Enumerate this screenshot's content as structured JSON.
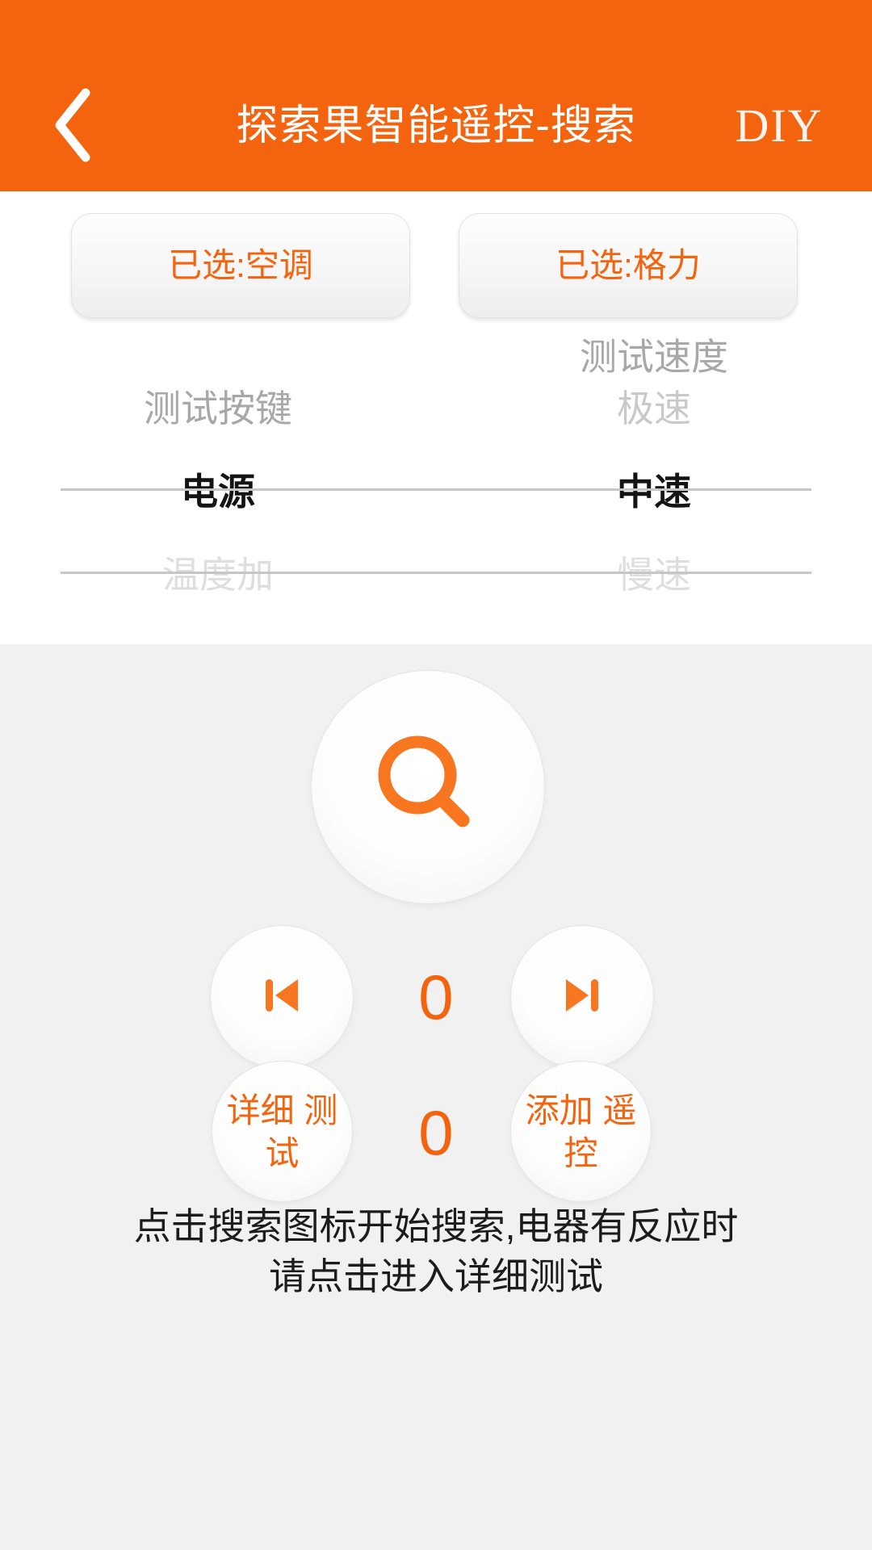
{
  "header": {
    "back_icon": "chevron-left-icon",
    "title": "探索果智能遥控-搜索",
    "diy_label": "DIY",
    "background_color": "#f4630e",
    "text_color": "#ffffff"
  },
  "selectors": [
    {
      "label": "已选:空调",
      "name": "device-type-selector"
    },
    {
      "label": "已选:格力",
      "name": "device-brand-selector"
    }
  ],
  "picker": {
    "accent_color": "#f4630e",
    "columns": [
      {
        "name": "test-key-column",
        "header": "测试按键",
        "rows": [
          "",
          "测试按键",
          "电源",
          "温度加"
        ],
        "selected": "电源",
        "selected_index": 2
      },
      {
        "name": "test-speed-column",
        "header": "测试速度",
        "rows": [
          "测试速度",
          "极速",
          "中速",
          "慢速"
        ],
        "selected": "中速",
        "selected_index": 2
      }
    ]
  },
  "panel": {
    "background_color": "#f1f1f1",
    "search_button": {
      "icon": "magnifier-icon",
      "name": "search-button"
    },
    "prev_button": {
      "icon": "skip-previous-icon",
      "name": "previous-code-button"
    },
    "next_button": {
      "icon": "skip-next-icon",
      "name": "next-code-button"
    },
    "detail_button": {
      "line1": "详细",
      "line2": "测试",
      "name": "detail-test-button"
    },
    "add_button": {
      "line1": "添加",
      "line2": "遥控",
      "name": "add-remote-button"
    },
    "counter_top": "0",
    "counter_bottom": "0",
    "hint_line1": "点击搜索图标开始搜索,电器有反应时",
    "hint_line2": "请点击进入详细测试"
  }
}
